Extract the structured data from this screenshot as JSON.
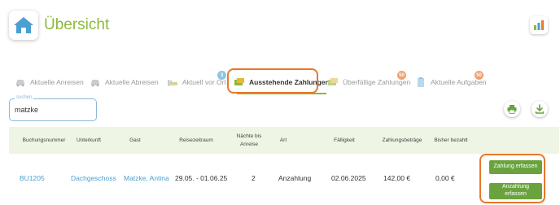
{
  "header": {
    "title": "Übersicht"
  },
  "tabs": [
    {
      "label": "Aktuelle Anreisen",
      "icon": "car-icon"
    },
    {
      "label": "Aktuelle Abreisen",
      "icon": "car-icon"
    },
    {
      "label": "Aktuell vor Ort",
      "icon": "bed-icon",
      "badge": "3"
    },
    {
      "label": "Ausstehende Zahlungen",
      "icon": "cash-icon",
      "active": true
    },
    {
      "label": "Überfällige Zahlungen",
      "icon": "cash-icon",
      "badge": "50"
    },
    {
      "label": "Aktuelle Aufgaben",
      "icon": "clipboard-icon",
      "badge": "50"
    }
  ],
  "colors": {
    "accent": "#8cb93c",
    "highlight": "#e8782c",
    "button": "#6aa33d",
    "link": "#4aa0d0",
    "badge_blue": "#8ec5e0",
    "badge_orange": "#f0a070"
  },
  "search": {
    "label": "suchen",
    "value": "matzke"
  },
  "table": {
    "headers": {
      "buchungsnummer": "Buchungsnummer",
      "unterkunft": "Unterkunft",
      "gast": "Gast",
      "reisezeitraum": "Reisezeitraum",
      "naechte_line1": "Nächte bis",
      "naechte_line2": "Anreise",
      "art": "Art",
      "faelligkeit": "Fälligkeit",
      "zahlungsbetraege": "Zahlungsbeträge",
      "bisher_bezahlt": "Bisher bezahlt"
    },
    "rows": [
      {
        "buchungsnummer": "BU1205",
        "unterkunft": "Dachgeschoss",
        "gast": "Matzke, Antina",
        "reisezeitraum": "29.05. - 01.06.25",
        "naechte": "2",
        "art": "Anzahlung",
        "faelligkeit": "02.06.2025",
        "zahlungsbetrag": "142,00 €",
        "bisher_bezahlt": "0,00 €",
        "btn_zahlung": "Zahlung erfassen",
        "btn_anzahlung_line1": "Anzahlung",
        "btn_anzahlung_line2": "erfassen"
      }
    ]
  }
}
